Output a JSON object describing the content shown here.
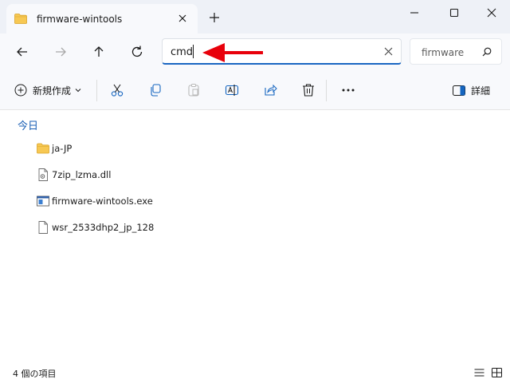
{
  "window": {
    "tab_title": "firmware-wintools"
  },
  "address_bar": {
    "value": "cmd"
  },
  "search": {
    "placeholder": "firmware"
  },
  "toolbar": {
    "new_label": "新規作成",
    "details_label": "詳細"
  },
  "content": {
    "group_header": "今日",
    "items": [
      {
        "name": "ja-JP",
        "icon": "folder-icon"
      },
      {
        "name": "7zip_lzma.dll",
        "icon": "dll-file-icon"
      },
      {
        "name": "firmware-wintools.exe",
        "icon": "exe-file-icon"
      },
      {
        "name": "wsr_2533dhp2_jp_128",
        "icon": "file-icon"
      }
    ]
  },
  "status": {
    "item_count": "4 個の項目"
  },
  "colors": {
    "accent": "#1a66c2",
    "annotation_arrow": "#e8000b",
    "folder": "#f2c04c"
  }
}
